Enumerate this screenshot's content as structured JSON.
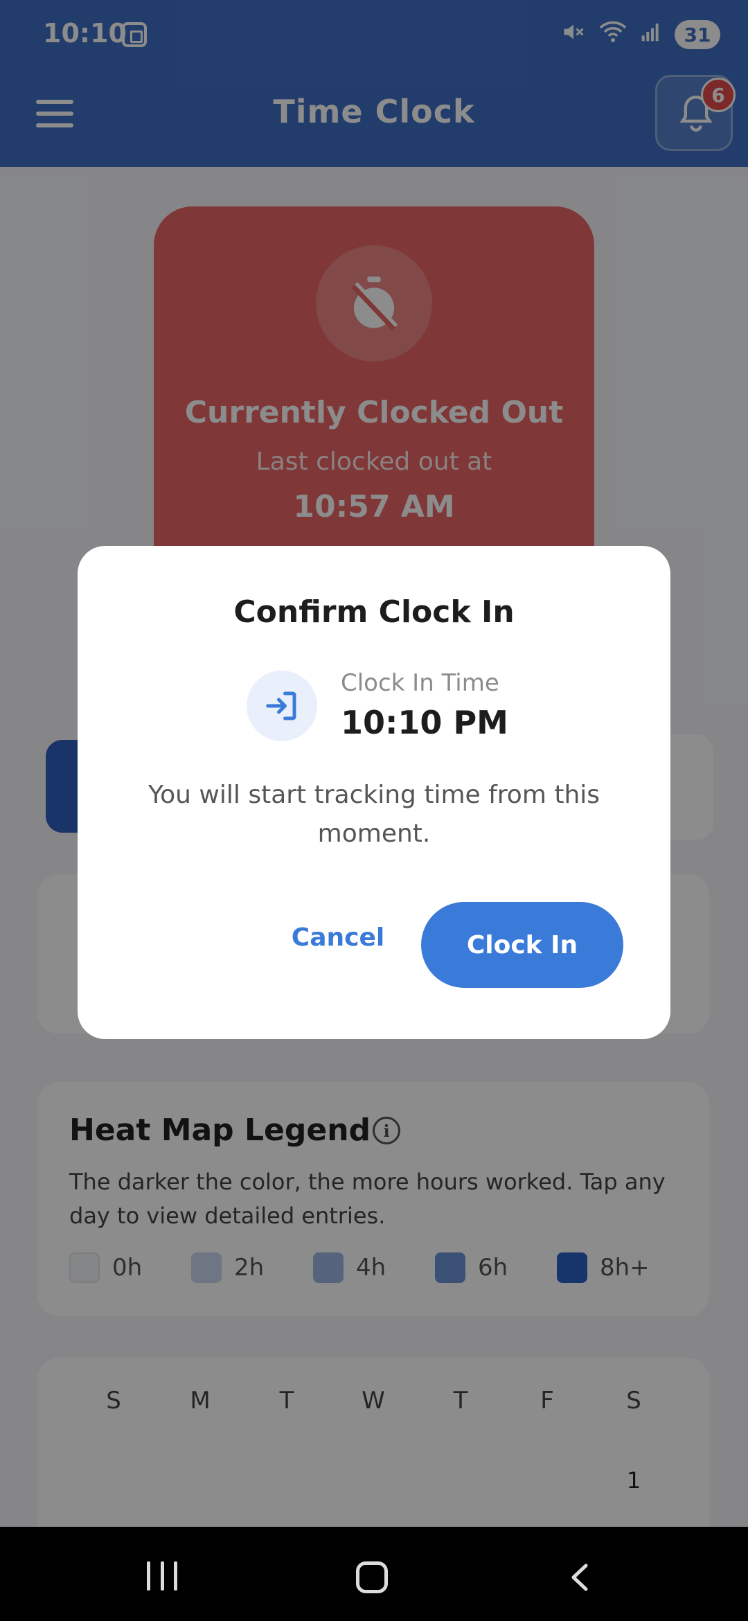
{
  "status_bar": {
    "time": "10:10",
    "battery": "31",
    "icons": [
      "screenshot-icon",
      "mute-icon",
      "wifi-icon",
      "signal-icon"
    ]
  },
  "header": {
    "title": "Time Clock",
    "notification_count": "6",
    "icons": [
      "menu-icon",
      "bell-icon"
    ]
  },
  "status_card": {
    "title": "Currently Clocked Out",
    "subtitle": "Last clocked out at",
    "time": "10:57 AM",
    "icon": "timer-off-icon",
    "color": "#e86464"
  },
  "modal": {
    "title": "Confirm Clock In",
    "time_label": "Clock In Time",
    "time_value": "10:10 PM",
    "message": "You will start tracking time from this moment.",
    "cancel_label": "Cancel",
    "confirm_label": "Clock In",
    "icon": "login-arrow-icon",
    "accent": "#3a7ad8"
  },
  "legend": {
    "title": "Heat Map Legend",
    "description": "The darker the color, the more hours worked. Tap any day to view detailed entries.",
    "levels": [
      {
        "label": "0h",
        "color": "#f3f4f7"
      },
      {
        "label": "2h",
        "color": "#c9d8ef"
      },
      {
        "label": "4h",
        "color": "#9bb6e2"
      },
      {
        "label": "6h",
        "color": "#6c93d6"
      },
      {
        "label": "8h+",
        "color": "#2b5fc4"
      }
    ]
  },
  "calendar": {
    "weekdays": [
      "S",
      "M",
      "T",
      "W",
      "T",
      "F",
      "S"
    ],
    "first_day": "1"
  }
}
